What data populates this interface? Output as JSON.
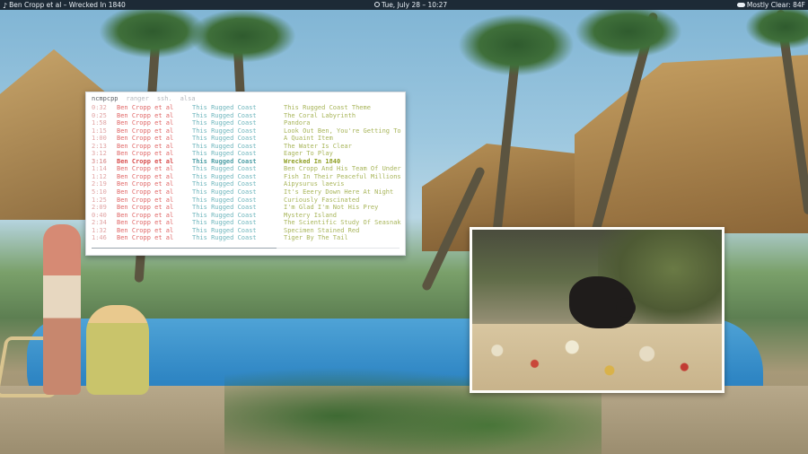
{
  "topbar": {
    "now_playing": "Ben Cropp et al – Wrecked In 1840",
    "clock": "Tue, July 28 – 10:27",
    "weather": "Mostly Clear: 84F"
  },
  "terminal": {
    "tabs": [
      "ncmpcpp",
      "ranger",
      "ssh.",
      "alsa"
    ],
    "active_tab": "ncmpcpp",
    "current_index": 8,
    "progress_fraction": 0.6,
    "playlist": [
      {
        "time": "0:32",
        "artist": "Ben Cropp et al",
        "album": "This Rugged Coast",
        "title": "This Rugged Coast Theme"
      },
      {
        "time": "0:25",
        "artist": "Ben Cropp et al",
        "album": "This Rugged Coast",
        "title": "The Coral Labyrinth"
      },
      {
        "time": "1:58",
        "artist": "Ben Cropp et al",
        "album": "This Rugged Coast",
        "title": "Pandora"
      },
      {
        "time": "1:15",
        "artist": "Ben Cropp et al",
        "album": "This Rugged Coast",
        "title": "Look Out Ben, You're Getting To"
      },
      {
        "time": "1:00",
        "artist": "Ben Cropp et al",
        "album": "This Rugged Coast",
        "title": "A Quaint Item"
      },
      {
        "time": "2:13",
        "artist": "Ben Cropp et al",
        "album": "This Rugged Coast",
        "title": "The Water Is Clear"
      },
      {
        "time": "3:12",
        "artist": "Ben Cropp et al",
        "album": "This Rugged Coast",
        "title": "Eager To Play"
      },
      {
        "time": "3:16",
        "artist": "Ben Cropp et al",
        "album": "This Rugged Coast",
        "title": "Wrecked In 1840"
      },
      {
        "time": "1:14",
        "artist": "Ben Cropp et al",
        "album": "This Rugged Coast",
        "title": "Ben Cropp And His Team Of Under"
      },
      {
        "time": "1:12",
        "artist": "Ben Cropp et al",
        "album": "This Rugged Coast",
        "title": "Fish In Their Peaceful Millions"
      },
      {
        "time": "2:19",
        "artist": "Ben Cropp et al",
        "album": "This Rugged Coast",
        "title": "Aipysurus laevis"
      },
      {
        "time": "5:10",
        "artist": "Ben Cropp et al",
        "album": "This Rugged Coast",
        "title": "It's Eeery Down Here At Night"
      },
      {
        "time": "1:25",
        "artist": "Ben Cropp et al",
        "album": "This Rugged Coast",
        "title": "Curiously Fascinated"
      },
      {
        "time": "2:09",
        "artist": "Ben Cropp et al",
        "album": "This Rugged Coast",
        "title": "I'm Glad I'm Not His Prey"
      },
      {
        "time": "0:40",
        "artist": "Ben Cropp et al",
        "album": "This Rugged Coast",
        "title": "Mystery Island"
      },
      {
        "time": "2:34",
        "artist": "Ben Cropp et al",
        "album": "This Rugged Coast",
        "title": "The Scientific Study Of Seasnak"
      },
      {
        "time": "1:32",
        "artist": "Ben Cropp et al",
        "album": "This Rugged Coast",
        "title": "Specimen Stained Red"
      },
      {
        "time": "1:46",
        "artist": "Ben Cropp et al",
        "album": "This Rugged Coast",
        "title": "Tiger By The Tail"
      }
    ]
  },
  "colors": {
    "time": "#e0a3a3",
    "artist": "#e06767",
    "album": "#6fb6bd",
    "title": "#a8b55a",
    "topbar_bg": "#1d2a36"
  }
}
